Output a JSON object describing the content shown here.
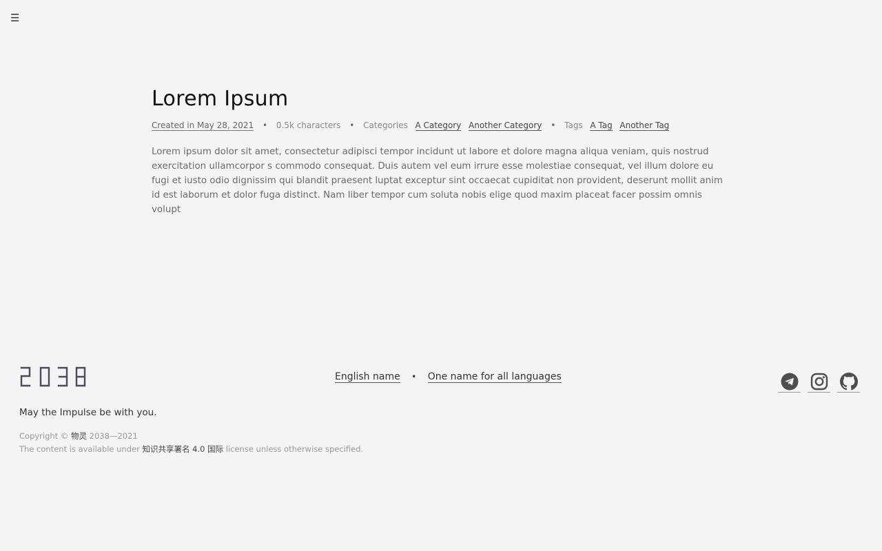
{
  "menu": {
    "icon": "hamburger-icon",
    "glyph": "☰"
  },
  "post": {
    "title": "Lorem Ipsum",
    "created": "Created in May 28, 2021",
    "characters": "0.5k characters",
    "categories_label": "Categories",
    "categories": [
      "A Category",
      "Another Category"
    ],
    "tags_label": "Tags",
    "tags": [
      "A Tag",
      "Another Tag"
    ],
    "body": "Lorem ipsum dolor sit amet, consectetur adipisci tempor incidunt ut labore et dolore magna aliqua veniam, quis nostrud exercitation ullamcorpor s commodo consequat. Duis autem vel eum irrure esse molestiae consequat, vel illum dolore eu fugi et iusto odio dignissim qui blandit praesent luptat exceptur sint occaecat cupiditat non provident, deserunt mollit anim id est laborum et dolor fuga distinct. Nam liber tempor cum soluta nobis elige quod maxim placeat facer possim omnis volupt"
  },
  "footer": {
    "logo": "2038",
    "names": [
      "English name",
      "One name for all languages"
    ],
    "socials": [
      {
        "name": "telegram-icon"
      },
      {
        "name": "instagram-icon"
      },
      {
        "name": "github-icon"
      }
    ],
    "motto": "May the Impulse be with you.",
    "copyright_prefix": "Copyright © ",
    "copyright_owner": "物灵",
    "copyright_years": " 2038—2021",
    "license_prefix": "The content is available under ",
    "license_name": "知识共享署名 4.0 国际",
    "license_suffix": " license unless otherwise specified."
  },
  "colors": {
    "background": "#f4f4f4",
    "title": "#111111",
    "text": "#6a6a6a",
    "logo": "#4a4a5a"
  }
}
